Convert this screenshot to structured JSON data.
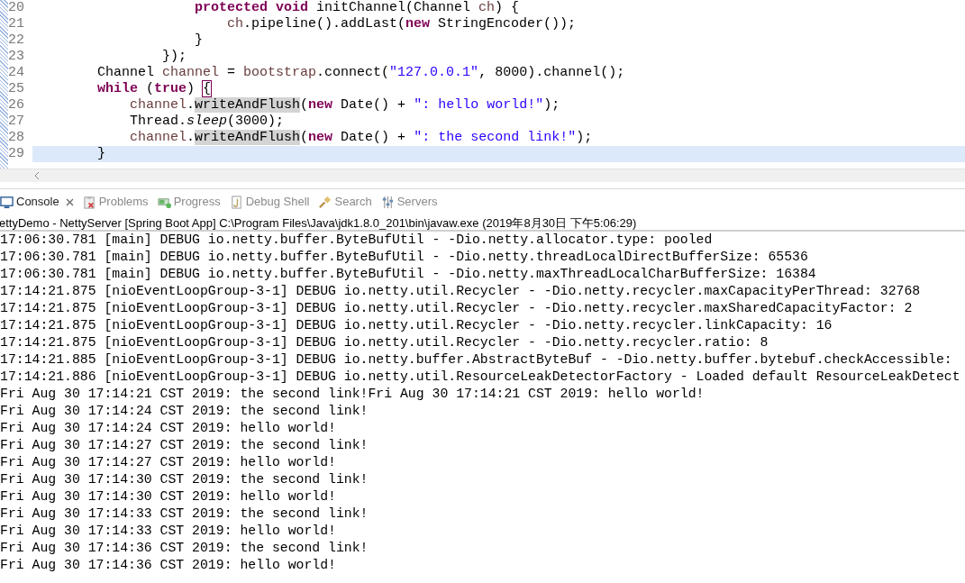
{
  "editor": {
    "lines": [
      {
        "number": "20",
        "current": false,
        "tokens": [
          {
            "kind": "keyword",
            "text": "                    protected void"
          },
          {
            "kind": "plain",
            "text": " initChannel(Channel "
          },
          {
            "kind": "local",
            "text": "ch"
          },
          {
            "kind": "plain",
            "text": ") {"
          }
        ]
      },
      {
        "number": "21",
        "current": false,
        "tokens": [
          {
            "kind": "local",
            "text": "                        ch"
          },
          {
            "kind": "plain",
            "text": ".pipeline().addLast("
          },
          {
            "kind": "keyword",
            "text": "new"
          },
          {
            "kind": "plain",
            "text": " StringEncoder());"
          }
        ]
      },
      {
        "number": "22",
        "current": false,
        "tokens": [
          {
            "kind": "plain",
            "text": "                    }"
          }
        ]
      },
      {
        "number": "23",
        "current": false,
        "tokens": [
          {
            "kind": "plain",
            "text": "                });"
          }
        ]
      },
      {
        "number": "24",
        "current": false,
        "tokens": [
          {
            "kind": "plain",
            "text": "        Channel "
          },
          {
            "kind": "local",
            "text": "channel"
          },
          {
            "kind": "plain",
            "text": " = "
          },
          {
            "kind": "local",
            "text": "bootstrap"
          },
          {
            "kind": "plain",
            "text": ".connect("
          },
          {
            "kind": "string",
            "text": "\"127.0.0.1\""
          },
          {
            "kind": "plain",
            "text": ", 8000).channel();"
          }
        ]
      },
      {
        "number": "25",
        "current": false,
        "tokens": [
          {
            "kind": "keyword",
            "text": "        while"
          },
          {
            "kind": "plain",
            "text": " ("
          },
          {
            "kind": "keyword",
            "text": "true"
          },
          {
            "kind": "plain",
            "text": ") "
          },
          {
            "kind": "bracket",
            "text": "{"
          }
        ]
      },
      {
        "number": "26",
        "current": false,
        "tokens": [
          {
            "kind": "local",
            "text": "            channel"
          },
          {
            "kind": "plain",
            "text": "."
          },
          {
            "kind": "occurrence",
            "text": "writeAndFlush"
          },
          {
            "kind": "plain",
            "text": "("
          },
          {
            "kind": "keyword",
            "text": "new"
          },
          {
            "kind": "plain",
            "text": " Date() + "
          },
          {
            "kind": "string",
            "text": "\": hello world!\""
          },
          {
            "kind": "plain",
            "text": ");"
          }
        ]
      },
      {
        "number": "27",
        "current": false,
        "tokens": [
          {
            "kind": "plain",
            "text": "            Thread."
          },
          {
            "kind": "static",
            "text": "sleep"
          },
          {
            "kind": "plain",
            "text": "(3000);"
          }
        ]
      },
      {
        "number": "28",
        "current": false,
        "tokens": [
          {
            "kind": "local",
            "text": "            channel"
          },
          {
            "kind": "plain",
            "text": "."
          },
          {
            "kind": "occurrence",
            "text": "writeAndFlush"
          },
          {
            "kind": "plain",
            "text": "("
          },
          {
            "kind": "keyword",
            "text": "new"
          },
          {
            "kind": "plain",
            "text": " Date() + "
          },
          {
            "kind": "string",
            "text": "\": the second link!\""
          },
          {
            "kind": "plain",
            "text": ");"
          }
        ]
      },
      {
        "number": "29",
        "current": true,
        "tokens": [
          {
            "kind": "plain",
            "text": "        }"
          }
        ]
      }
    ]
  },
  "tabs": [
    {
      "label": "Console",
      "selected": true,
      "closable": true
    },
    {
      "label": "Problems",
      "selected": false,
      "closable": false
    },
    {
      "label": "Progress",
      "selected": false,
      "closable": false
    },
    {
      "label": "Debug Shell",
      "selected": false,
      "closable": false
    },
    {
      "label": "Search",
      "selected": false,
      "closable": false
    },
    {
      "label": "Servers",
      "selected": false,
      "closable": false
    }
  ],
  "launch": "ettyDemo - NettyServer [Spring Boot App] C:\\Program Files\\Java\\jdk1.8.0_201\\bin\\javaw.exe (2019年8月30日 下午5:06:29)",
  "output": [
    "17:06:30.781 [main] DEBUG io.netty.buffer.ByteBufUtil - -Dio.netty.allocator.type: pooled",
    "17:06:30.781 [main] DEBUG io.netty.buffer.ByteBufUtil - -Dio.netty.threadLocalDirectBufferSize: 65536",
    "17:06:30.781 [main] DEBUG io.netty.buffer.ByteBufUtil - -Dio.netty.maxThreadLocalCharBufferSize: 16384",
    "17:14:21.875 [nioEventLoopGroup-3-1] DEBUG io.netty.util.Recycler - -Dio.netty.recycler.maxCapacityPerThread: 32768",
    "17:14:21.875 [nioEventLoopGroup-3-1] DEBUG io.netty.util.Recycler - -Dio.netty.recycler.maxSharedCapacityFactor: 2",
    "17:14:21.875 [nioEventLoopGroup-3-1] DEBUG io.netty.util.Recycler - -Dio.netty.recycler.linkCapacity: 16",
    "17:14:21.875 [nioEventLoopGroup-3-1] DEBUG io.netty.util.Recycler - -Dio.netty.recycler.ratio: 8",
    "17:14:21.885 [nioEventLoopGroup-3-1] DEBUG io.netty.buffer.AbstractByteBuf - -Dio.netty.buffer.bytebuf.checkAccessible:",
    "17:14:21.886 [nioEventLoopGroup-3-1] DEBUG io.netty.util.ResourceLeakDetectorFactory - Loaded default ResourceLeakDetect",
    "Fri Aug 30 17:14:21 CST 2019: the second link!Fri Aug 30 17:14:21 CST 2019: hello world!",
    "Fri Aug 30 17:14:24 CST 2019: the second link!",
    "Fri Aug 30 17:14:24 CST 2019: hello world!",
    "Fri Aug 30 17:14:27 CST 2019: the second link!",
    "Fri Aug 30 17:14:27 CST 2019: hello world!",
    "Fri Aug 30 17:14:30 CST 2019: the second link!",
    "Fri Aug 30 17:14:30 CST 2019: hello world!",
    "Fri Aug 30 17:14:33 CST 2019: the second link!",
    "Fri Aug 30 17:14:33 CST 2019: hello world!",
    "Fri Aug 30 17:14:36 CST 2019: the second link!",
    "Fri Aug 30 17:14:36 CST 2019: hello world!"
  ]
}
